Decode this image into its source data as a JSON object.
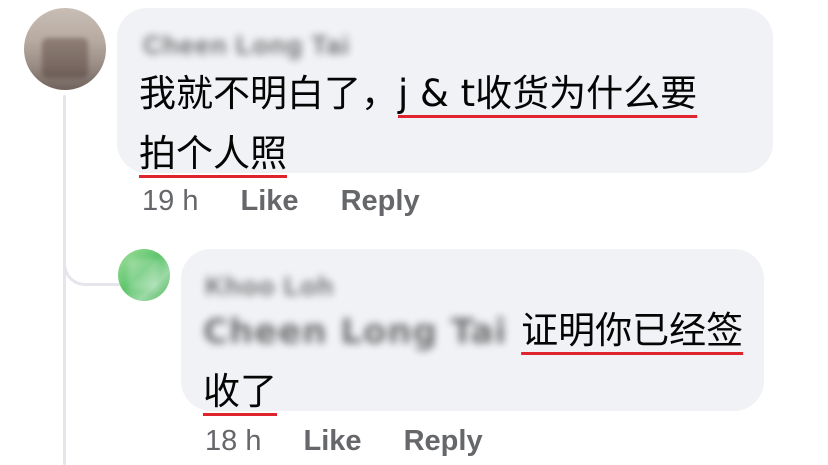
{
  "comments": [
    {
      "author": "Cheen Long Tai",
      "text_parts": [
        "我就不明白了，",
        "j & t收货为什么要",
        "拍个人照"
      ],
      "time": "19 h",
      "like_label": "Like",
      "reply_label": "Reply"
    }
  ],
  "reply": {
    "author": "Khoo Loh",
    "mention": "Cheen Long Tai",
    "text_parts": [
      "证明你已经签",
      "收了"
    ],
    "time": "18 h",
    "like_label": "Like",
    "reply_label": "Reply"
  },
  "colors": {
    "bubble": "#f0f2f5",
    "underline": "#e0242e",
    "meta_text": "#65676b"
  }
}
